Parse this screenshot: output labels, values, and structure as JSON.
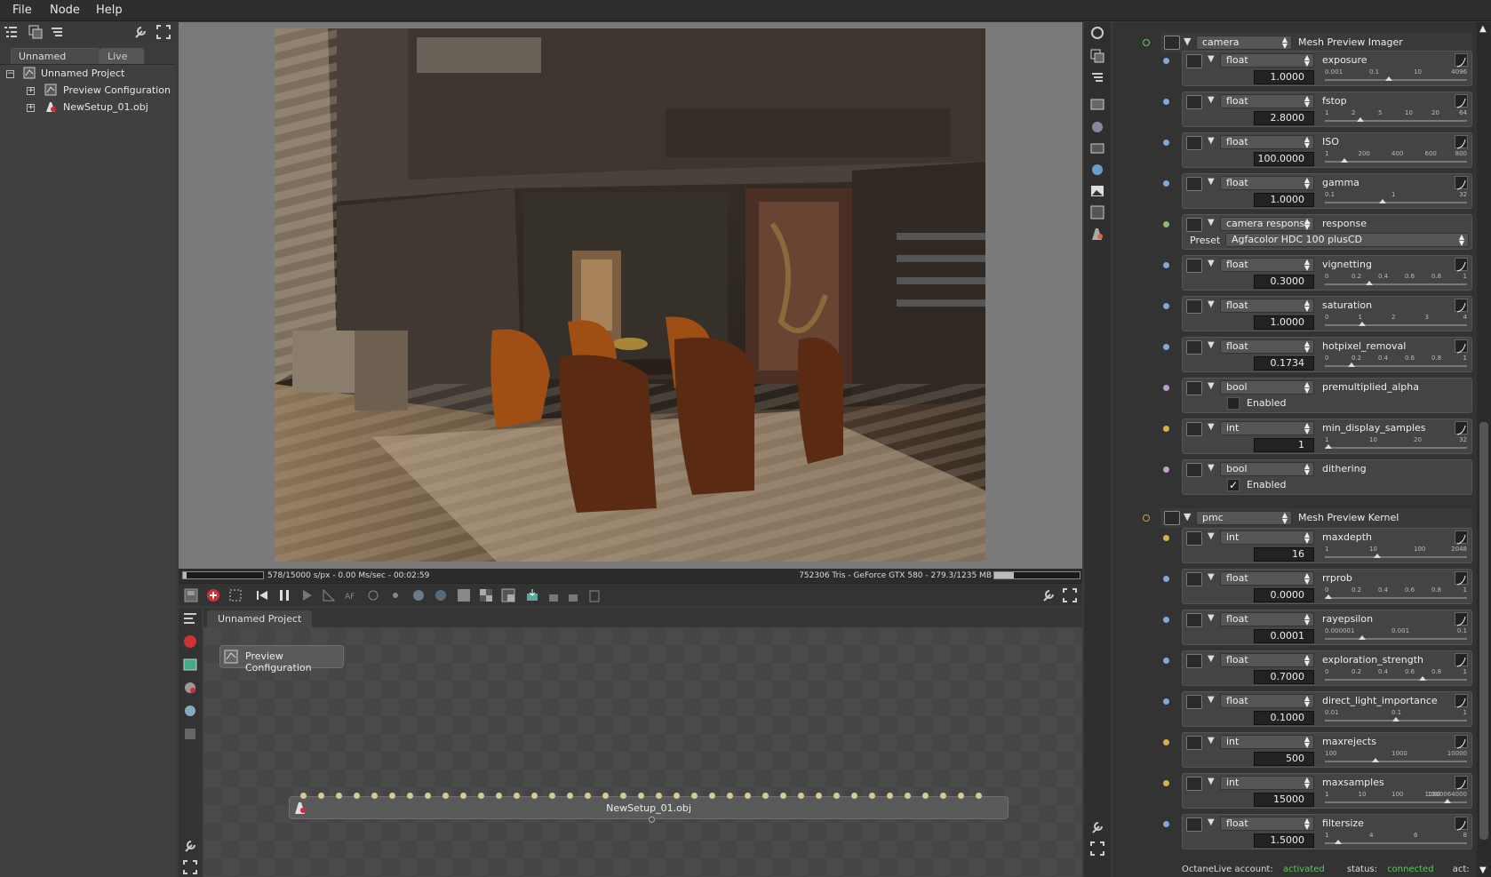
{
  "menu": [
    "File",
    "Node",
    "Help"
  ],
  "scene_tabs": {
    "project": "Unnamed Project",
    "livedb": "Live DB"
  },
  "tree": {
    "root": "Unnamed Project",
    "items": [
      "Preview Configuration",
      "NewSetup_01.obj"
    ]
  },
  "render_status": {
    "left": "578/15000 s/px - 0.00 Ms/sec - 00:02:59",
    "right": "752306 Tris - GeForce GTX 580 - 279.3/1235 MB",
    "progress": 0.04,
    "memory": 0.23
  },
  "node_graph": {
    "tab": "Unnamed Project",
    "nodes": {
      "preview": "Preview Configuration",
      "mesh": "NewSetup_01.obj"
    }
  },
  "inspector": {
    "camera_group": {
      "type": "camera",
      "name": "Mesh Preview Imager"
    },
    "camera_params": [
      {
        "type": "float",
        "name": "exposure",
        "value": "1.0000",
        "ticks": [
          "0.001",
          "0.1",
          "10",
          "4096"
        ],
        "pos": 0.45
      },
      {
        "type": "float",
        "name": "fstop",
        "value": "2.8000",
        "ticks": [
          "1",
          "2",
          "5",
          "10",
          "20",
          "64"
        ],
        "pos": 0.24
      },
      {
        "type": "float",
        "name": "ISO",
        "value": "100.0000",
        "ticks": [
          "1",
          "200",
          "400",
          "600",
          "800"
        ],
        "pos": 0.12
      },
      {
        "type": "float",
        "name": "gamma",
        "value": "1.0000",
        "ticks": [
          "0.1",
          "1",
          "32"
        ],
        "pos": 0.4
      },
      {
        "type": "camera response",
        "name": "response",
        "preset_label": "Preset",
        "preset": "Agfacolor HDC 100 plusCD"
      },
      {
        "type": "float",
        "name": "vignetting",
        "value": "0.3000",
        "ticks": [
          "0",
          "0.2",
          "0.4",
          "0.6",
          "0.8",
          "1"
        ],
        "pos": 0.3
      },
      {
        "type": "float",
        "name": "saturation",
        "value": "1.0000",
        "ticks": [
          "0",
          "1",
          "2",
          "3",
          "4"
        ],
        "pos": 0.25
      },
      {
        "type": "float",
        "name": "hotpixel_removal",
        "value": "0.1734",
        "ticks": [
          "0",
          "0.2",
          "0.4",
          "0.6",
          "0.8",
          "1"
        ],
        "pos": 0.17
      },
      {
        "type": "bool",
        "name": "premultiplied_alpha",
        "check": "",
        "label": "Enabled"
      },
      {
        "type": "int",
        "name": "min_display_samples",
        "value": "1",
        "ticks": [
          "1",
          "10",
          "20",
          "32"
        ],
        "pos": 0.0
      },
      {
        "type": "bool",
        "name": "dithering",
        "check": "✓",
        "label": "Enabled"
      }
    ],
    "kernel_group": {
      "type": "pmc",
      "name": "Mesh Preview Kernel"
    },
    "kernel_params": [
      {
        "type": "int",
        "name": "maxdepth",
        "value": "16",
        "ticks": [
          "1",
          "10",
          "100",
          "2048"
        ],
        "pos": 0.36
      },
      {
        "type": "float",
        "name": "rrprob",
        "value": "0.0000",
        "ticks": [
          "0",
          "0.2",
          "0.4",
          "0.6",
          "0.8",
          "1"
        ],
        "pos": 0.0
      },
      {
        "type": "float",
        "name": "rayepsilon",
        "value": "0.0001",
        "ticks": [
          "0.000001",
          "0.001",
          "0.1"
        ],
        "pos": 0.25
      },
      {
        "type": "float",
        "name": "exploration_strength",
        "value": "0.7000",
        "ticks": [
          "0",
          "0.2",
          "0.4",
          "0.6",
          "0.8",
          "1"
        ],
        "pos": 0.7
      },
      {
        "type": "float",
        "name": "direct_light_importance",
        "value": "0.1000",
        "ticks": [
          "0.01",
          "0.1",
          "1"
        ],
        "pos": 0.5
      },
      {
        "type": "int",
        "name": "maxrejects",
        "value": "500",
        "ticks": [
          "100",
          "1000",
          "10000"
        ],
        "pos": 0.35
      },
      {
        "type": "int",
        "name": "maxsamples",
        "value": "15000",
        "ticks": [
          "1",
          "10",
          "100",
          "1000",
          "1000064000"
        ],
        "pos": 0.88
      },
      {
        "type": "float",
        "name": "filtersize",
        "value": "1.5000",
        "ticks": [
          "1",
          "4",
          "6",
          "8"
        ],
        "pos": 0.07
      }
    ]
  },
  "footer": {
    "account_label": "OctaneLive account:",
    "account_value": "activated",
    "status_label": "status:",
    "status_value": "connected",
    "act_label": "act:"
  },
  "colors": {
    "accent_green": "#5ac85a",
    "pin_blue": "#7fa9d8",
    "pin_yellow": "#d8b04a",
    "pin_purple": "#c09ad0"
  }
}
